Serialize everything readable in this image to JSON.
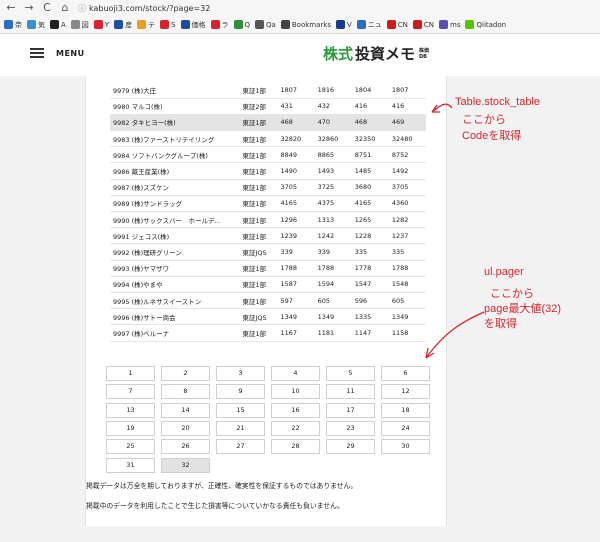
{
  "browser": {
    "nav": {
      "back": "←",
      "forward": "→",
      "reload": "C",
      "home": "⌂"
    },
    "url": "kabuoji3.com/stock/?page=32",
    "bookmarks": [
      {
        "label": "奈",
        "color": "#2b6cc4"
      },
      {
        "label": "気",
        "color": "#3a8fd8"
      },
      {
        "label": "A",
        "color": "#222222"
      },
      {
        "label": "図",
        "color": "#888888"
      },
      {
        "label": "Y",
        "color": "#e0212b"
      },
      {
        "label": "産",
        "color": "#1f4fa0"
      },
      {
        "label": "テ",
        "color": "#e9a020"
      },
      {
        "label": "S",
        "color": "#d8232a"
      },
      {
        "label": "価格",
        "color": "#1d4f9c"
      },
      {
        "label": "ラ",
        "color": "#d8232a"
      },
      {
        "label": "Q",
        "color": "#2f8f3a"
      },
      {
        "label": "Qa",
        "color": "#555555"
      },
      {
        "label": "Bookmarks",
        "color": "#444444"
      },
      {
        "label": "V",
        "color": "#1a3a8c"
      },
      {
        "label": "ニュ",
        "color": "#2a6fc4"
      },
      {
        "label": "CN",
        "color": "#cc1d1d"
      },
      {
        "label": "CN",
        "color": "#cc1d1d"
      },
      {
        "label": "ms",
        "color": "#5a4fb0"
      },
      {
        "label": "Qiitadon",
        "color": "#55c500"
      }
    ]
  },
  "header": {
    "menu_label": "MENU",
    "logo_green": "株式",
    "logo_dark": "投資メモ",
    "logo_sub_top": "株価",
    "logo_sub_bottom": "DB"
  },
  "stock_table": {
    "rows": [
      {
        "name": "9979 (株)大庄",
        "market": "東証1部",
        "v1": "1807",
        "v2": "1816",
        "v3": "1804",
        "v4": "1807"
      },
      {
        "name": "9980 マルコ(株)",
        "market": "東証2部",
        "v1": "431",
        "v2": "432",
        "v3": "416",
        "v4": "416"
      },
      {
        "name": "9982 タキヒヨー(株)",
        "market": "東証1部",
        "v1": "468",
        "v2": "470",
        "v3": "468",
        "v4": "469"
      },
      {
        "name": "9983 (株)ファーストリテイリング",
        "market": "東証1部",
        "v1": "32820",
        "v2": "32860",
        "v3": "32350",
        "v4": "32480"
      },
      {
        "name": "9984 ソフトバンクグループ(株)",
        "market": "東証1部",
        "v1": "8849",
        "v2": "8865",
        "v3": "8751",
        "v4": "8752"
      },
      {
        "name": "9986 蔵王産業(株)",
        "market": "東証1部",
        "v1": "1490",
        "v2": "1493",
        "v3": "1485",
        "v4": "1492"
      },
      {
        "name": "9987 (株)スズケン",
        "market": "東証1部",
        "v1": "3705",
        "v2": "3725",
        "v3": "3680",
        "v4": "3705"
      },
      {
        "name": "9989 (株)サンドラッグ",
        "market": "東証1部",
        "v1": "4165",
        "v2": "4375",
        "v3": "4165",
        "v4": "4360"
      },
      {
        "name": "9990 (株)サックスバー　ホールデ…",
        "market": "東証1部",
        "v1": "1296",
        "v2": "1313",
        "v3": "1265",
        "v4": "1282"
      },
      {
        "name": "9991 ジェコス(株)",
        "market": "東証1部",
        "v1": "1239",
        "v2": "1242",
        "v3": "1228",
        "v4": "1237"
      },
      {
        "name": "9992 (株)理研グリーン",
        "market": "東証JQS",
        "v1": "339",
        "v2": "339",
        "v3": "335",
        "v4": "335"
      },
      {
        "name": "9993 (株)ヤマザワ",
        "market": "東証1部",
        "v1": "1788",
        "v2": "1788",
        "v3": "1778",
        "v4": "1788"
      },
      {
        "name": "9994 (株)やまや",
        "market": "東証1部",
        "v1": "1587",
        "v2": "1594",
        "v3": "1547",
        "v4": "1548"
      },
      {
        "name": "9995 (株)ルネサスイーストン",
        "market": "東証1部",
        "v1": "597",
        "v2": "605",
        "v3": "596",
        "v4": "605"
      },
      {
        "name": "9996 (株)サトー商会",
        "market": "東証JQS",
        "v1": "1349",
        "v2": "1349",
        "v3": "1335",
        "v4": "1349"
      },
      {
        "name": "9997 (株)ベルーナ",
        "market": "東証1部",
        "v1": "1167",
        "v2": "1181",
        "v3": "1147",
        "v4": "1158"
      }
    ],
    "highlighted_row": 2
  },
  "pager": {
    "pages": [
      "1",
      "2",
      "3",
      "4",
      "5",
      "6",
      "7",
      "8",
      "9",
      "10",
      "11",
      "12",
      "13",
      "14",
      "15",
      "16",
      "17",
      "18",
      "19",
      "20",
      "21",
      "22",
      "23",
      "24",
      "25",
      "26",
      "27",
      "28",
      "29",
      "30",
      "31",
      "32"
    ],
    "current": "32"
  },
  "disclaimer": [
    "掲載データは万全を期しておりますが、正確性、確実性を保証するものではありません。",
    "掲載中のデータを利用したことで生じた損害等についていかなる責任も負いません。"
  ],
  "annotations": {
    "table_selector": "Table.stock_table",
    "table_line2": "ここから",
    "table_line3": "Codeを取得",
    "pager_selector": "ul.pager",
    "pager_line2": "ここから",
    "pager_line3": "page最大値(32)",
    "pager_line4": "を取得",
    "color": "#d9262c"
  }
}
